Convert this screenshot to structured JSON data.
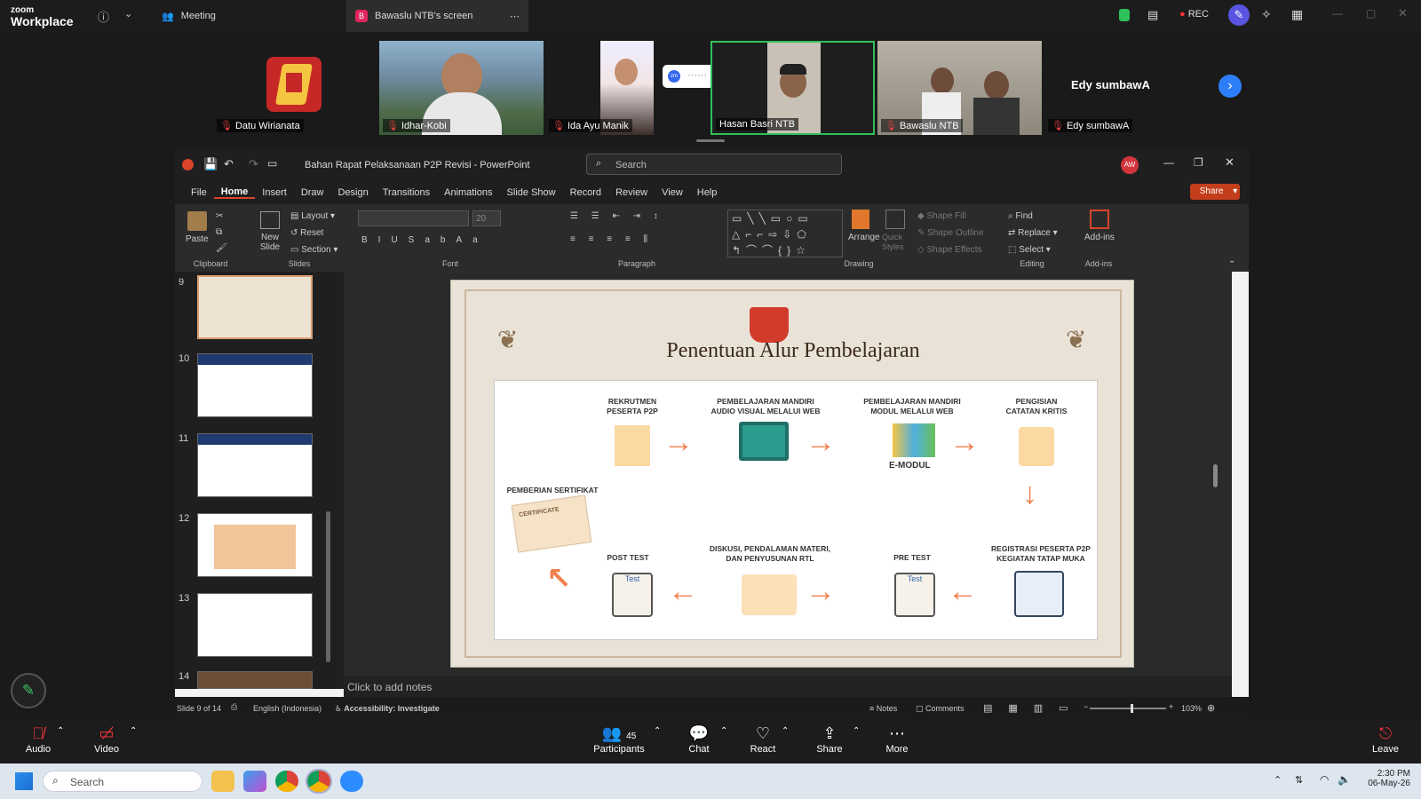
{
  "zoom": {
    "brand_small": "zoom",
    "brand": "Workplace",
    "meeting_tab": "Meeting",
    "share_tab": "Bawaslu NTB's screen",
    "share_badge": "B",
    "rec": "REC",
    "participants": [
      {
        "name": "Datu Wirianata"
      },
      {
        "name": "Idhar-Kobi"
      },
      {
        "name": "Ida Ayu Manik"
      },
      {
        "name": "Hasan Basri NTB"
      },
      {
        "name": "Bawaslu NTB"
      },
      {
        "name": "Edy sumbawA"
      }
    ],
    "edy_center_label": "Edy sumbawA",
    "controls": {
      "audio": "Audio",
      "video": "Video",
      "participants": "Participants",
      "participants_count": "45",
      "chat": "Chat",
      "react": "React",
      "share": "Share",
      "more": "More",
      "leave": "Leave"
    }
  },
  "ppt": {
    "title": "Bahan Rapat Pelaksanaan P2P Revisi  -  PowerPoint",
    "search_placeholder": "Search",
    "avatar": "AW",
    "share_btn": "Share",
    "menu": [
      "File",
      "Home",
      "Insert",
      "Draw",
      "Design",
      "Transitions",
      "Animations",
      "Slide Show",
      "Record",
      "Review",
      "View",
      "Help"
    ],
    "ribbon": {
      "paste": "Paste",
      "new_slide": "New Slide",
      "layout": "Layout",
      "reset": "Reset",
      "section": "Section",
      "clipboard": "Clipboard",
      "slides": "Slides",
      "font": "Font",
      "font_size": "20",
      "paragraph": "Paragraph",
      "drawing": "Drawing",
      "arrange": "Arrange",
      "quick_styles": "Quick Styles",
      "shape_fill": "Shape Fill",
      "shape_outline": "Shape Outline",
      "shape_effects": "Shape Effects",
      "find": "Find",
      "replace": "Replace",
      "select": "Select",
      "editing": "Editing",
      "addins": "Add-ins",
      "addins_group": "Add-ins"
    },
    "thumbs": [
      "9",
      "10",
      "11",
      "12",
      "13",
      "14"
    ],
    "notes_placeholder": "Click to add notes",
    "status": {
      "slide": "Slide 9 of 14",
      "language": "English (Indonesia)",
      "accessibility": "Accessibility: Investigate",
      "notes": "Notes",
      "comments": "Comments",
      "zoom": "103%"
    },
    "slide": {
      "title": "Penentuan Alur Pembelajaran",
      "steps": {
        "s1": "REKRUTMEN\nPESERTA P2P",
        "s2": "PEMBELAJARAN MANDIRI\nAUDIO VISUAL MELALUI WEB",
        "s3": "PEMBELAJARAN MANDIRI\nMODUL MELALUI WEB",
        "s3_sub": "E-MODUL",
        "s4": "PENGISIAN\nCATATAN KRITIS",
        "s5": "REGISTRASI PESERTA P2P\nKEGIATAN TATAP MUKA",
        "s6": "PRE TEST",
        "s7": "DISKUSI, PENDALAMAN MATERI,\nDAN PENYUSUNAN RTL",
        "s8": "POST TEST",
        "s9": "PEMBERIAN SERTIFIKAT",
        "cert": "CERTIFICATE",
        "test": "Test"
      }
    }
  },
  "taskbar": {
    "search": "Search",
    "time": "2:30 PM",
    "date": "06-May-26"
  }
}
